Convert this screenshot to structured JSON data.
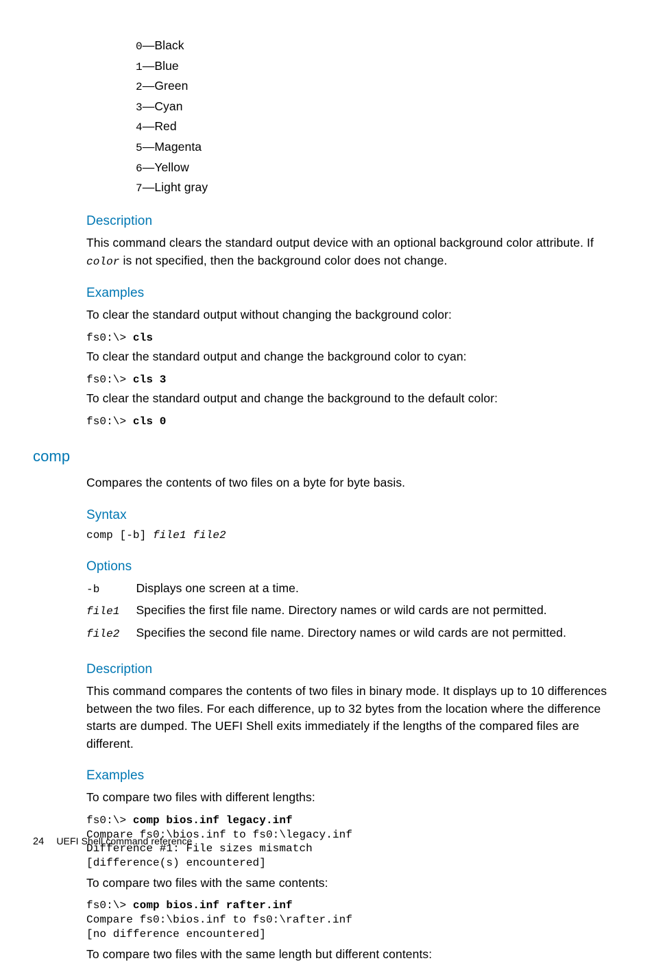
{
  "colors": [
    {
      "code": "0",
      "name": "Black"
    },
    {
      "code": "1",
      "name": "Blue"
    },
    {
      "code": "2",
      "name": "Green"
    },
    {
      "code": "3",
      "name": "Cyan"
    },
    {
      "code": "4",
      "name": "Red"
    },
    {
      "code": "5",
      "name": "Magenta"
    },
    {
      "code": "6",
      "name": "Yellow"
    },
    {
      "code": "7",
      "name": "Light gray"
    }
  ],
  "cls": {
    "desc_heading": "Description",
    "desc_text_a": "This command clears the standard output device with an optional background color attribute. If ",
    "desc_code": "color",
    "desc_text_b": " is not specified, then the background color does not change.",
    "examples_heading": "Examples",
    "ex1_label": "To clear the standard output without changing the background color:",
    "ex1_prompt": "fs0:\\> ",
    "ex1_cmd": "cls",
    "ex2_label": "To clear the standard output and change the background color to cyan:",
    "ex2_prompt": "fs0:\\> ",
    "ex2_cmd": "cls 3",
    "ex3_label": "To clear the standard output and change the background to the default color:",
    "ex3_prompt": "fs0:\\> ",
    "ex3_cmd": "cls 0"
  },
  "comp": {
    "heading": "comp",
    "summary": "Compares the contents of two files on a byte for byte basis.",
    "syntax_heading": "Syntax",
    "syntax_cmd": "comp",
    "syntax_flag": " [-b] ",
    "syntax_args": "file1 file2",
    "options_heading": "Options",
    "options": [
      {
        "term": "-b",
        "term_italic": false,
        "desc": "Displays one screen at a time."
      },
      {
        "term": "file1",
        "term_italic": true,
        "desc": "Specifies the first file name. Directory names or wild cards are not permitted."
      },
      {
        "term": "file2",
        "term_italic": true,
        "desc": "Specifies the second file name. Directory names or wild cards are not permitted."
      }
    ],
    "desc_heading": "Description",
    "desc_text": "This command compares the contents of two files in binary mode. It displays up to 10 differences between the two files. For each difference, up to 32 bytes from the location where the difference starts are dumped. The UEFI Shell exits immediately if the lengths of the compared files are different.",
    "examples_heading": "Examples",
    "ex1_label": "To compare two files with different lengths:",
    "ex1_prompt": "fs0:\\> ",
    "ex1_cmd": "comp bios.inf legacy.inf",
    "ex1_out1": "Compare fs0:\\bios.inf to fs0:\\legacy.inf",
    "ex1_out2": "Difference #1: File sizes mismatch",
    "ex1_out3": "[difference(s) encountered]",
    "ex2_label": "To compare two files with the same contents:",
    "ex2_prompt": "fs0:\\> ",
    "ex2_cmd": "comp bios.inf rafter.inf",
    "ex2_out1": "Compare fs0:\\bios.inf to fs0:\\rafter.inf",
    "ex2_out2": "[no difference encountered]",
    "ex3_label": "To compare two files with the same length but different contents:"
  },
  "footer": {
    "page": "24",
    "title": "UEFI Shell command reference"
  }
}
